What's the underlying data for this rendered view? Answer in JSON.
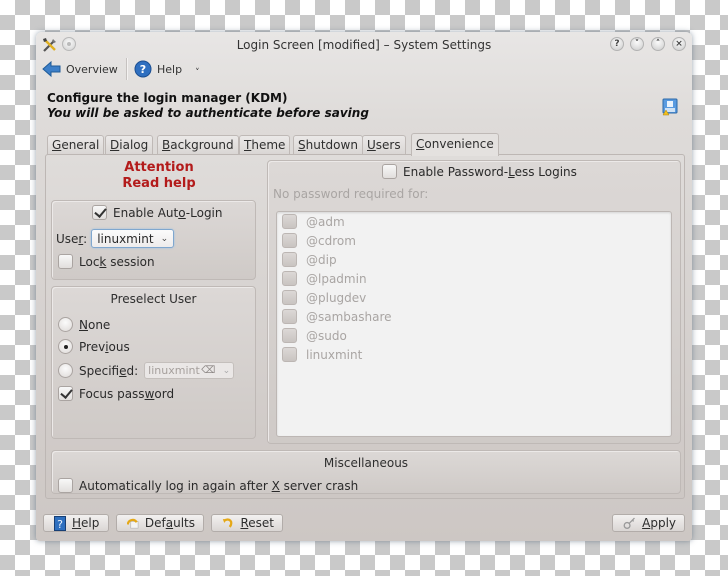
{
  "window": {
    "title": "Login Screen [modified] – System Settings",
    "controls": [
      "help-icon",
      "minimize-icon",
      "maximize-icon",
      "close-icon"
    ],
    "control_glyphs": [
      "?",
      "˅",
      "˄",
      "×"
    ]
  },
  "toolbar": {
    "overview_label": "Overview",
    "help_label": "Help",
    "help_menu_caret": "˅"
  },
  "header": {
    "title": "Configure the login manager (KDM)",
    "subtitle": "You will be asked to authenticate before saving"
  },
  "tabs": [
    {
      "label": "General",
      "mnemonic": "G",
      "rest": "eneral",
      "active": false
    },
    {
      "label": "Dialog",
      "mnemonic": "D",
      "rest": "ialog",
      "active": false
    },
    {
      "label": "Background",
      "mnemonic": "B",
      "rest": "ackground",
      "active": false
    },
    {
      "label": "Theme",
      "mnemonic": "T",
      "rest": "heme",
      "active": false
    },
    {
      "label": "Shutdown",
      "mnemonic": "S",
      "rest": "hutdown",
      "active": false
    },
    {
      "label": "Users",
      "mnemonic": "U",
      "rest": "sers",
      "active": false
    },
    {
      "label": "Convenience",
      "mnemonic": "C",
      "rest": "onvenience",
      "active": true
    }
  ],
  "convenience": {
    "attention_line1": "Attention",
    "attention_line2": "Read help",
    "autologin": {
      "label_pre": "Enable Aut",
      "label_mn": "o",
      "label_post": "-Login",
      "checked": true,
      "user_label_pre": "Use",
      "user_label_mn": "r",
      "user_label_post": ":",
      "user_value": "linuxmint",
      "lock_label_pre": "Loc",
      "lock_label_mn": "k",
      "lock_label_post": " session",
      "lock_checked": false
    },
    "preselect": {
      "title": "Preselect User",
      "none_mn": "N",
      "none_rest": "one",
      "previous_pre": "Prev",
      "previous_mn": "i",
      "previous_post": "ous",
      "specified_pre": "Specifi",
      "specified_mn": "e",
      "specified_post": "d:",
      "specified_value": "linuxmint",
      "selected": "Previous",
      "focus_pre": "Focus pass",
      "focus_mn": "w",
      "focus_post": "ord",
      "focus_checked": true
    },
    "passwordless": {
      "label_pre": "Enable Password-",
      "label_mn": "L",
      "label_post": "ess Logins",
      "checked": false,
      "no_password_label": "No password required for:",
      "items": [
        "@adm",
        "@cdrom",
        "@dip",
        "@lpadmin",
        "@plugdev",
        "@sambashare",
        "@sudo",
        "linuxmint"
      ]
    },
    "misc": {
      "title": "Miscellaneous",
      "relogin_pre": "Automatically log in again after ",
      "relogin_mn": "X",
      "relogin_post": " server crash",
      "relogin_checked": false
    }
  },
  "buttons": {
    "help_mn": "H",
    "help_rest": "elp",
    "defaults_pre": "Def",
    "defaults_mn": "a",
    "defaults_post": "ults",
    "reset_mn": "R",
    "reset_rest": "eset",
    "apply_mn": "A",
    "apply_rest": "pply"
  },
  "colors": {
    "attention": "#b31b1b",
    "focus_border": "#7fa7cf"
  }
}
